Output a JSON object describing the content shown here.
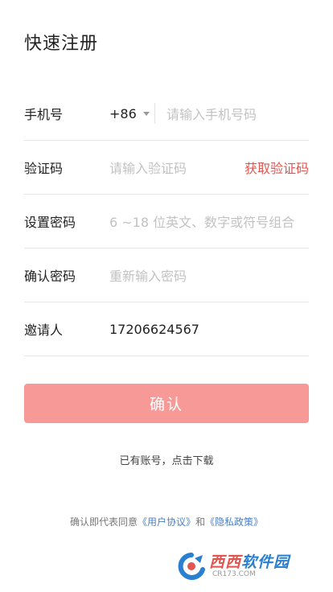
{
  "header": {
    "title": "快速注册"
  },
  "form": {
    "phone": {
      "label": "手机号",
      "country_code": "+86",
      "placeholder": "请输入手机号码"
    },
    "code": {
      "label": "验证码",
      "placeholder": "请输入验证码",
      "get_code_label": "获取验证码"
    },
    "password": {
      "label": "设置密码",
      "placeholder": "6 ~18 位英文、数字或符号组合"
    },
    "confirm_password": {
      "label": "确认密码",
      "placeholder": "重新输入密码"
    },
    "inviter": {
      "label": "邀请人",
      "value": "17206624567"
    }
  },
  "confirm_button": {
    "label": "确认"
  },
  "login_link": {
    "text": "已有账号，点击下载"
  },
  "agreement": {
    "prefix": "确认即代表同意",
    "user_agreement": "《用户协议》",
    "and": "和",
    "privacy_policy": "《隐私政策》"
  },
  "watermark": {
    "main_red": "西西",
    "main_blue": "软件园",
    "sub": "CR173.COM"
  },
  "colors": {
    "accent": "#e0554f",
    "button_bg": "#f79a97",
    "link": "#4a7fc1"
  }
}
